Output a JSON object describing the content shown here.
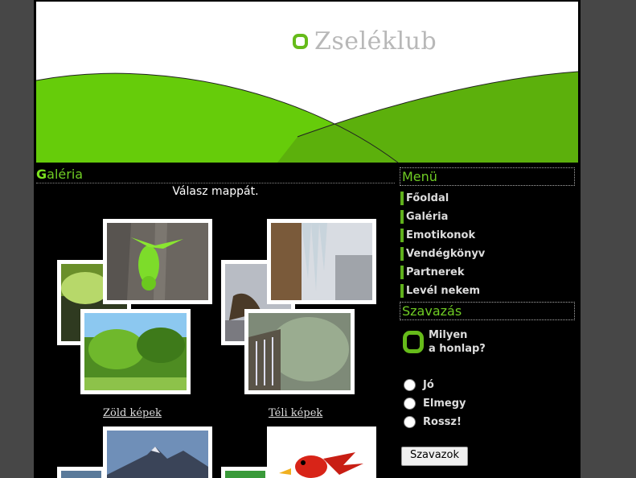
{
  "header": {
    "logo_text": "Zseléklub"
  },
  "gallery": {
    "title_first": "G",
    "title_rest": "aléria",
    "subtitle": "Válasz mappát.",
    "folders": [
      {
        "name": "Zöld képek"
      },
      {
        "name": "Téli képek"
      }
    ]
  },
  "sidebar": {
    "menu_title": "Menü",
    "menu_items": [
      {
        "label": "Főoldal"
      },
      {
        "label": "Galéria"
      },
      {
        "label": "Emotikonok"
      },
      {
        "label": "Vendégkönyv"
      },
      {
        "label": "Partnerek"
      },
      {
        "label": "Levél nekem"
      }
    ],
    "poll_title": "Szavazás",
    "poll_question_line1": "Milyen",
    "poll_question_line2": "a honlap?",
    "options": [
      {
        "label": "Jó"
      },
      {
        "label": "Elmegy"
      },
      {
        "label": "Rossz!"
      }
    ],
    "vote_button": "Szavazok"
  },
  "colors": {
    "accent_green": "#6fcc24",
    "page_bg": "#000000",
    "outer_bg": "#474747"
  }
}
